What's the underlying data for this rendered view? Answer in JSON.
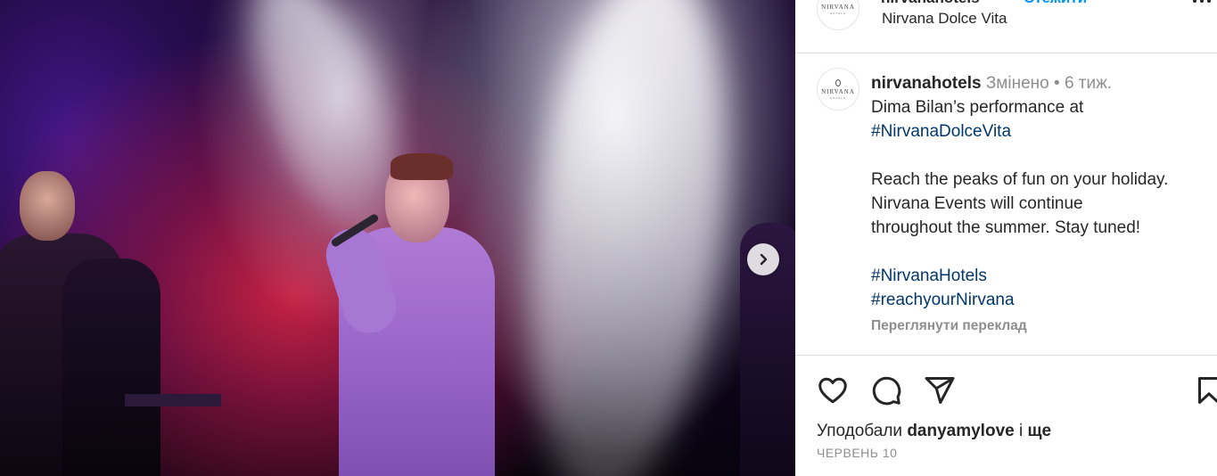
{
  "post": {
    "header": {
      "username": "nirvanahotels",
      "follow_label": "Стежити",
      "location": "Nirvana Dolce Vita",
      "avatar_logo_text": "NIRVANA",
      "avatar_logo_sub": "HOTELS"
    },
    "caption": {
      "username": "nirvanahotels",
      "edited": "Змінено",
      "separator": "•",
      "age": "6 тиж.",
      "line1": "Dima Bilan’s performance at",
      "tag1": "#NirvanaDolceVita",
      "line2": "Reach the peaks of fun on your holiday.",
      "line3": "Nirvana Events will continue",
      "line4": "throughout the summer. Stay tuned!",
      "tag2": "#NirvanaHotels",
      "tag3": "#reachyourNirvana",
      "translate_label": "Переглянути переклад"
    },
    "actions": {
      "like_icon": "heart-icon",
      "comment_icon": "comment-icon",
      "share_icon": "paper-plane-icon",
      "save_icon": "bookmark-icon"
    },
    "likes": {
      "prefix": "Уподобали",
      "user": "danyamylove",
      "suffix": "і ще"
    },
    "date": "ЧЕРВЕНЬ 10"
  },
  "media": {
    "next_icon": "chevron-right-icon"
  },
  "colors": {
    "link_blue": "#0095f6",
    "hashtag": "#00376b",
    "muted": "#8e8e8e",
    "text": "#262626",
    "divider": "#dbdbdb"
  }
}
